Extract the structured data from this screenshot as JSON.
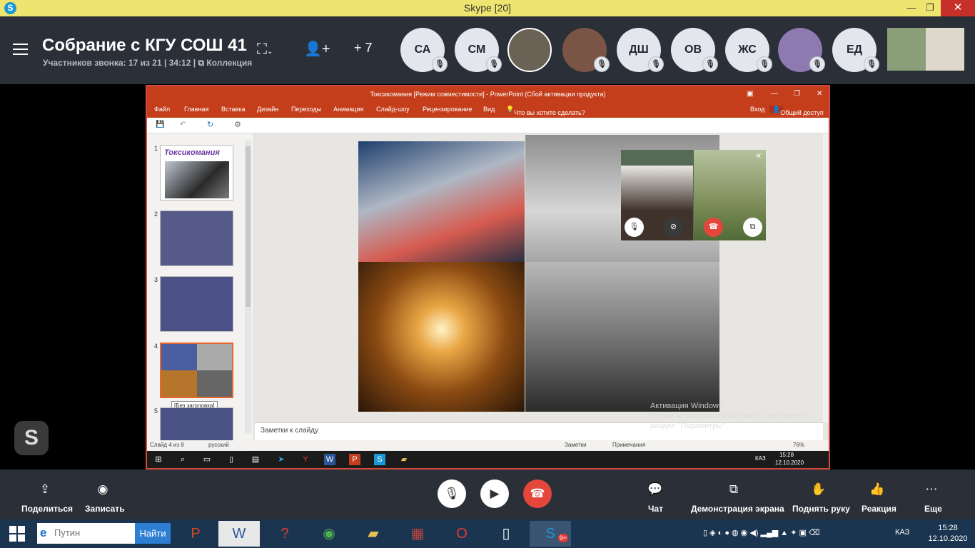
{
  "titlebar": {
    "app": "Skype",
    "badge": "20",
    "title": "Skype [20]"
  },
  "call": {
    "title": "Собрание с КГУ СОШ 41",
    "participants_label": "Участников звонка: 17 из 21",
    "duration": "34:12",
    "collection_label": "Коллекция",
    "more_count": "+ 7",
    "participants": [
      {
        "initials": "СА",
        "muted": true
      },
      {
        "initials": "СМ",
        "muted": true
      },
      {
        "initials": "",
        "photo": true,
        "muted": false
      },
      {
        "initials": "",
        "photo": true,
        "muted": true
      },
      {
        "initials": "ДШ",
        "muted": true
      },
      {
        "initials": "ОВ",
        "muted": true
      },
      {
        "initials": "ЖС",
        "muted": true
      },
      {
        "initials": "",
        "photo": true,
        "muted": true
      },
      {
        "initials": "ЕД",
        "muted": true
      }
    ]
  },
  "ppt": {
    "window_title": "Токсикомания [Режим совместимости] - PowerPoint (Сбой активации продукта)",
    "menu": [
      "Файл",
      "Главная",
      "Вставка",
      "Дизайн",
      "Переходы",
      "Анимация",
      "Слайд-шоу",
      "Рецензирование",
      "Вид"
    ],
    "tell_me": "Что вы хотите сделать?",
    "login": "Вход",
    "share": "Общий доступ",
    "slide1_title": "Токсикомания",
    "slide_numbers": [
      "1",
      "2",
      "3",
      "4",
      "5"
    ],
    "tooltip": "[Без заголовка]",
    "notes_placeholder": "Заметки к слайду",
    "status": {
      "slide": "Слайд 4 из 8",
      "lang": "русский",
      "notes": "Заметки",
      "comments": "Примечания",
      "zoom": "76%"
    },
    "taskbar_time": "15:28",
    "taskbar_date": "12.10.2020",
    "taskbar_lang": "КАЗ"
  },
  "watermark": {
    "line1": "Активация Windows",
    "line2": "Чтобы активировать Windows, перейдите в",
    "line3": "раздел \"Параметры\"."
  },
  "controls": {
    "share": "Поделиться",
    "record": "Записать",
    "chat": "Чат",
    "screen_share": "Демонстрация экрана",
    "raise_hand": "Поднять руку",
    "reaction": "Реакция",
    "more": "Еще"
  },
  "taskbar": {
    "search_placeholder": "Путин",
    "search_button": "Найти",
    "skype_badge": "9+",
    "lang": "КАЗ",
    "time": "15:28",
    "date": "12.10.2020"
  },
  "colors": {
    "skype_blue": "#1a97d5",
    "titlebar": "#ede56f",
    "header": "#2a2f38",
    "end_call": "#e4463a",
    "ppt_red": "#c43e1c"
  }
}
